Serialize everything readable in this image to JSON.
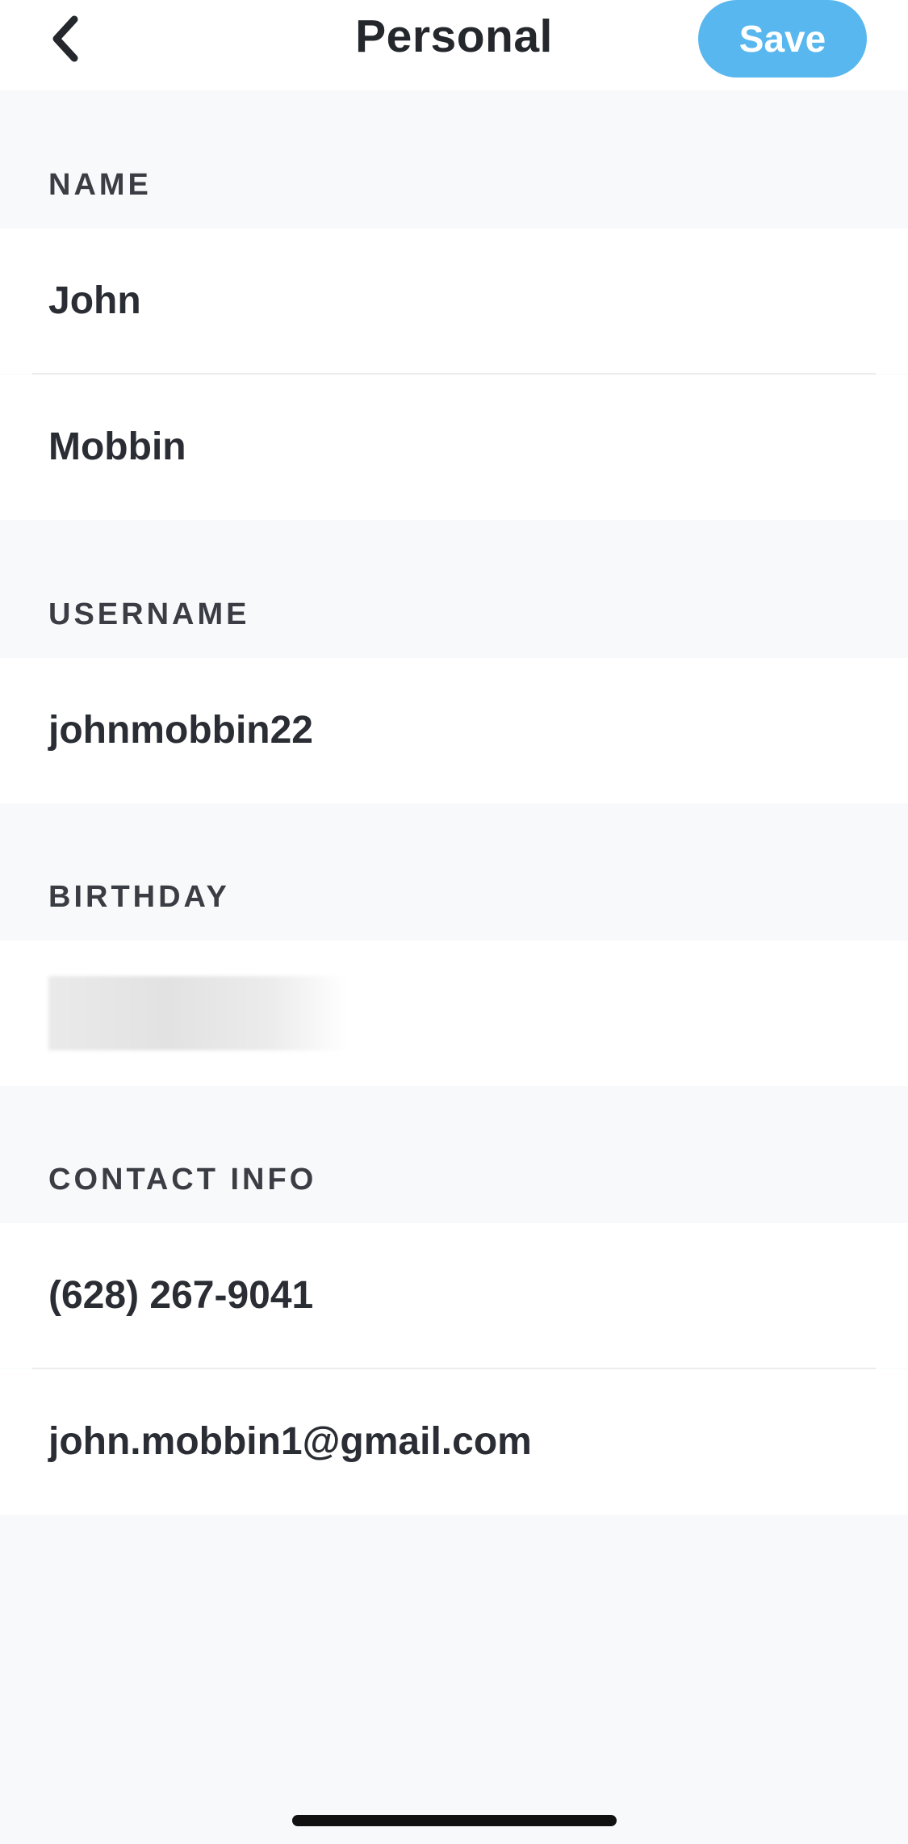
{
  "nav": {
    "title": "Personal",
    "save_label": "Save",
    "back_icon": "chevron-left-icon"
  },
  "sections": {
    "name": {
      "label": "NAME",
      "first_name": "John",
      "last_name": "Mobbin"
    },
    "username": {
      "label": "USERNAME",
      "value": "johnmobbin22"
    },
    "birthday": {
      "label": "BIRTHDAY"
    },
    "contact": {
      "label": "CONTACT INFO",
      "phone": "(628) 267-9041",
      "email": "john.mobbin1@gmail.com"
    }
  },
  "colors": {
    "accent": "#58b7ee",
    "background": "#f8f9fb",
    "text": "#24272c"
  }
}
